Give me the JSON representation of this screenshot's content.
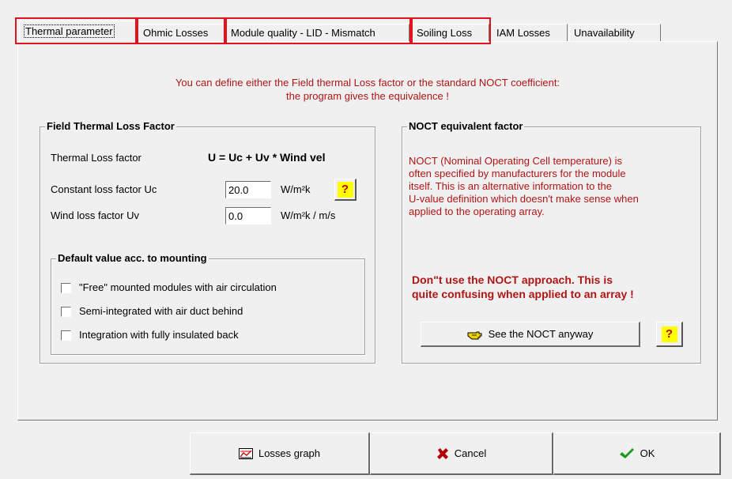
{
  "tabs": [
    {
      "label": "Thermal parameter"
    },
    {
      "label": "Ohmic Losses"
    },
    {
      "label": "Module quality - LID - Mismatch"
    },
    {
      "label": "Soiling Loss"
    },
    {
      "label": "IAM Losses"
    },
    {
      "label": "Unavailability"
    }
  ],
  "intro": {
    "line1": "You can define either the Field thermal Loss factor or the standard NOCT coefficient:",
    "line2": "the program gives the equivalence !"
  },
  "field_thermal": {
    "title": "Field Thermal Loss Factor",
    "loss_factor_label": "Thermal Loss factor",
    "formula": "U = Uc + Uv * Wind vel",
    "uc_label": "Constant loss factor  Uc",
    "uc_value": "20.0",
    "uc_unit": "W/m²k",
    "uv_label": "Wind loss factor  Uv",
    "uv_value": "0.0",
    "uv_unit": "W/m²k / m/s",
    "help": "?"
  },
  "default_mounting": {
    "title": "Default value acc. to mounting",
    "options": [
      {
        "label": "\"Free\" mounted modules with air circulation",
        "checked": false
      },
      {
        "label": "Semi-integrated with air duct behind",
        "checked": false
      },
      {
        "label": "Integration with fully insulated back",
        "checked": false
      }
    ]
  },
  "noct": {
    "title": "NOCT equivalent factor",
    "desc1": "NOCT  (Nominal Operating Cell temperature) is",
    "desc2": "often specified by manufacturers  for the module",
    "desc3": "itself. This is an alternative information to the",
    "desc4": "U-value definition which doesn't make sense when",
    "desc5": "applied to the operating array.",
    "warn1": "Don\"t use the NOCT approach. This is",
    "warn2": "quite confusing when applied to an array !",
    "button": "See the NOCT anyway",
    "help": "?"
  },
  "footer": {
    "graph": "Losses graph",
    "cancel": "Cancel",
    "ok": "OK"
  },
  "colors": {
    "highlight": "#e0141e",
    "text_red": "#b01515",
    "help_bg": "#ffff00"
  }
}
